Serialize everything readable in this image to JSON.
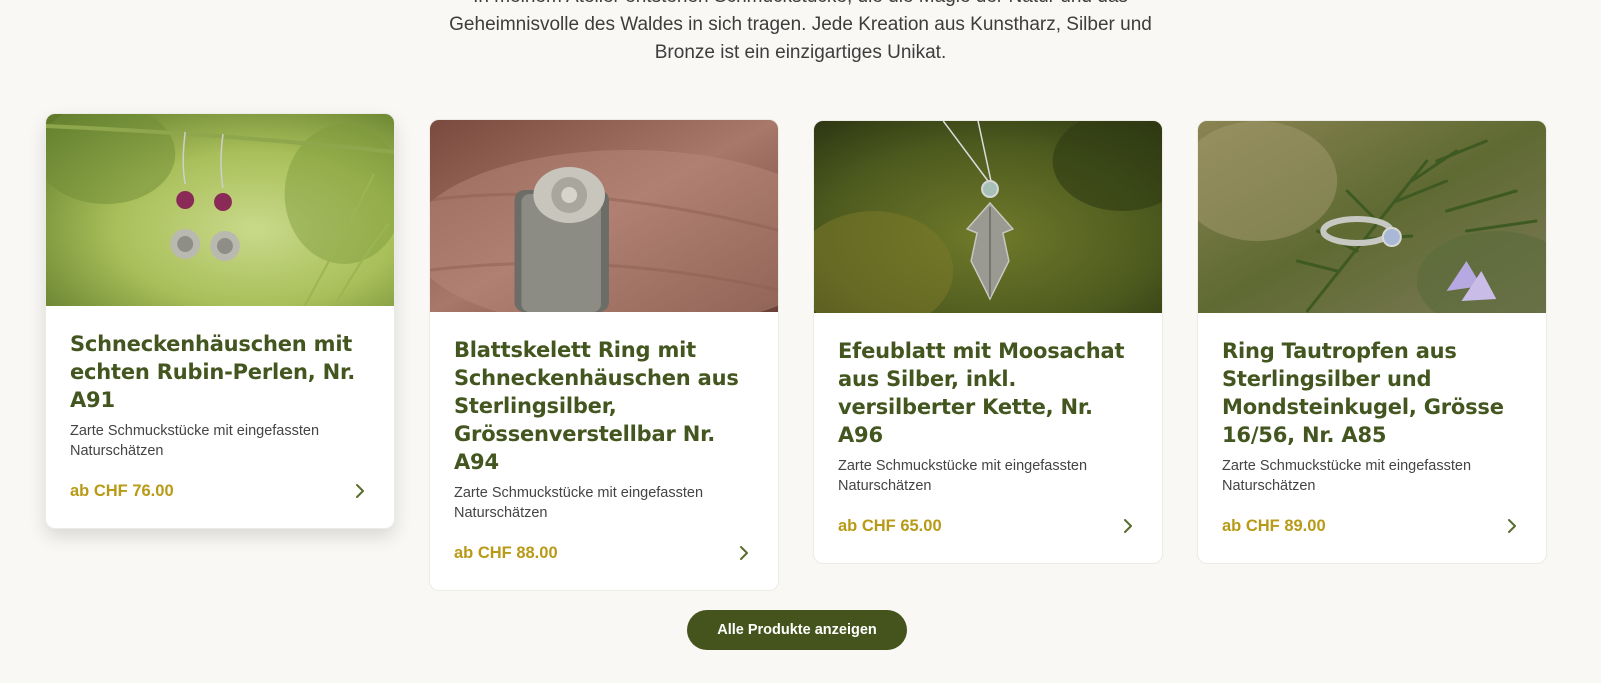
{
  "intro": {
    "line1": "In meinem Atelier entstehen Schmuckstücke, die die Magie der Natur und das",
    "line2": "Geheimnisvolle des Waldes in sich tragen. Jede Kreation aus Kunstharz, Silber und",
    "line3": "Bronze ist ein einzigartiges Unikat."
  },
  "products": [
    {
      "title": "Schneckenhäuschen mit echten Rubin-Perlen, Nr. A91",
      "description": "Zarte Schmuckstücke mit eingefassten Naturschätzen",
      "price": "ab CHF 76.00",
      "image_icon": "earrings-photo"
    },
    {
      "title": "Blattskelett Ring mit Schneckenhäuschen aus Sterlingsilber, Grössenverstellbar Nr. A94",
      "description": "Zarte Schmuckstücke mit eingefassten Naturschätzen",
      "price": "ab CHF 88.00",
      "image_icon": "ring-photo"
    },
    {
      "title": "Efeublatt mit Moosachat aus Silber, inkl. versilberter Kette, Nr. A96",
      "description": "Zarte Schmuckstücke mit eingefassten Naturschätzen",
      "price": "ab CHF 65.00",
      "image_icon": "pendant-photo"
    },
    {
      "title": "Ring Tautropfen aus Sterlingsilber und Mondsteinkugel, Grösse 16/56, Nr. A85",
      "description": "Zarte Schmuckstücke mit eingefassten Naturschätzen",
      "price": "ab CHF 89.00",
      "image_icon": "moonstone-ring-photo"
    }
  ],
  "cta": {
    "label": "Alle Produkte anzeigen"
  },
  "colors": {
    "background": "#f9f8f5",
    "title": "#44561f",
    "price": "#b89a17",
    "button": "#44541c"
  }
}
